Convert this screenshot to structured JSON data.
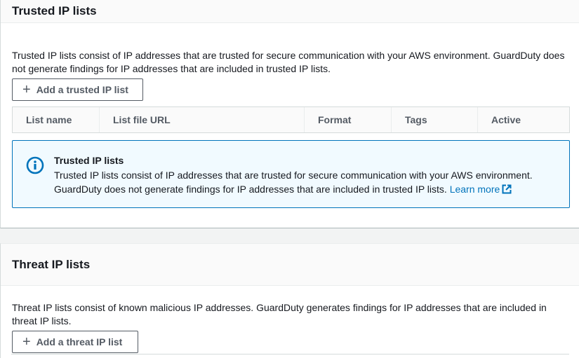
{
  "trusted": {
    "title": "Trusted IP lists",
    "description": "Trusted IP lists consist of IP addresses that are trusted for secure communication with your AWS environment. GuardDuty does not generate findings for IP addresses that are included in trusted IP lists.",
    "add_button": "Add a trusted IP list",
    "columns": [
      "List name",
      "List file URL",
      "Format",
      "Tags",
      "Active"
    ],
    "alert": {
      "title": "Trusted IP lists",
      "body": "Trusted IP lists consist of IP addresses that are trusted for secure communication with your AWS environment. GuardDuty does not generate findings for IP addresses that are included in trusted IP lists. ",
      "link": "Learn more"
    }
  },
  "threat": {
    "title": "Threat IP lists",
    "description": "Threat IP lists consist of known malicious IP addresses. GuardDuty generates findings for IP addresses that are included in threat IP lists.",
    "add_button": "Add a threat IP list"
  },
  "icons": {
    "info": "info-circle-icon",
    "external": "external-link-icon",
    "plus": "plus-icon"
  },
  "colors": {
    "link": "#0073bb",
    "alert_bg": "#f1faff",
    "alert_border": "#0073bb"
  }
}
